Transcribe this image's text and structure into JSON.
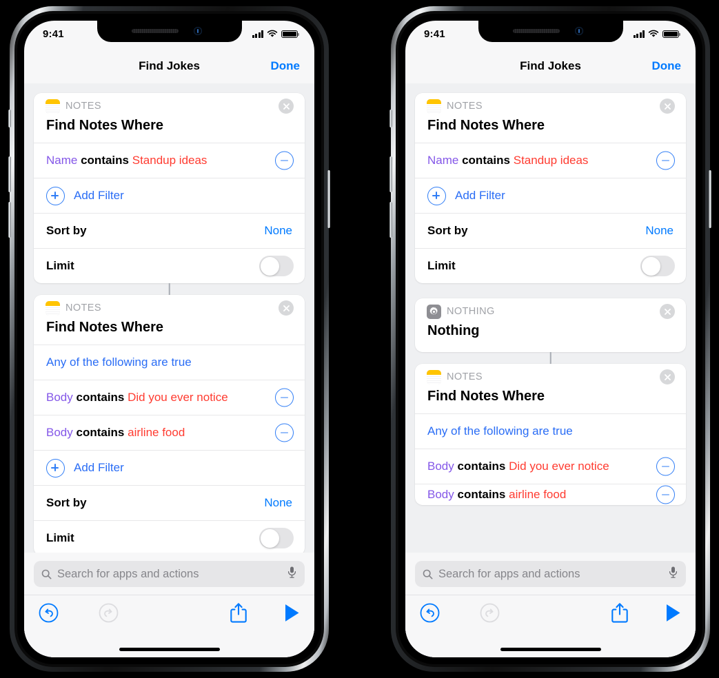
{
  "device": {
    "status_bar": {
      "time": "9:41",
      "signal_icon": "cellular-bars-icon",
      "wifi_icon": "wifi-icon",
      "battery_icon": "battery-full-icon"
    },
    "home_indicator": "home-indicator"
  },
  "nav": {
    "title": "Find Jokes",
    "done_label": "Done"
  },
  "bottom": {
    "search_placeholder": "Search for apps and actions",
    "search_icon": "search-icon",
    "mic_icon": "microphone-icon",
    "undo_icon": "undo-icon",
    "redo_icon": "redo-icon",
    "share_icon": "share-icon",
    "play_icon": "play-icon"
  },
  "labels": {
    "app_notes": "NOTES",
    "app_nothing": "NOTHING",
    "find_notes_where": "Find Notes Where",
    "nothing": "Nothing",
    "add_filter": "Add Filter",
    "sort_by": "Sort by",
    "sort_value": "None",
    "limit": "Limit",
    "any_true": "Any of the following are true",
    "contains": "contains",
    "close_icon": "close-icon",
    "minus_icon": "remove-filter-icon",
    "plus_icon": "add-filter-icon",
    "notes_icon": "notes-app-icon",
    "gear_icon": "gear-icon",
    "toggle_off": "limit-toggle-off"
  },
  "filters": {
    "name_standup": {
      "field": "Name",
      "op": "contains",
      "value": "Standup ideas"
    },
    "body_notice": {
      "field": "Body",
      "op": "contains",
      "value": "Did you ever notice"
    },
    "body_airline": {
      "field": "Body",
      "op": "contains",
      "value": "airline food"
    }
  },
  "colors": {
    "accent_blue": "#007aff",
    "variable_purple": "#8457e8",
    "value_red": "#ff3b30",
    "notes_yellow": "#ffc400",
    "card_bg": "#ffffff",
    "canvas_bg": "#eff0f2"
  },
  "phones": [
    {
      "id": "left",
      "name": "phone-left-before"
    },
    {
      "id": "right",
      "name": "phone-right-after"
    }
  ]
}
